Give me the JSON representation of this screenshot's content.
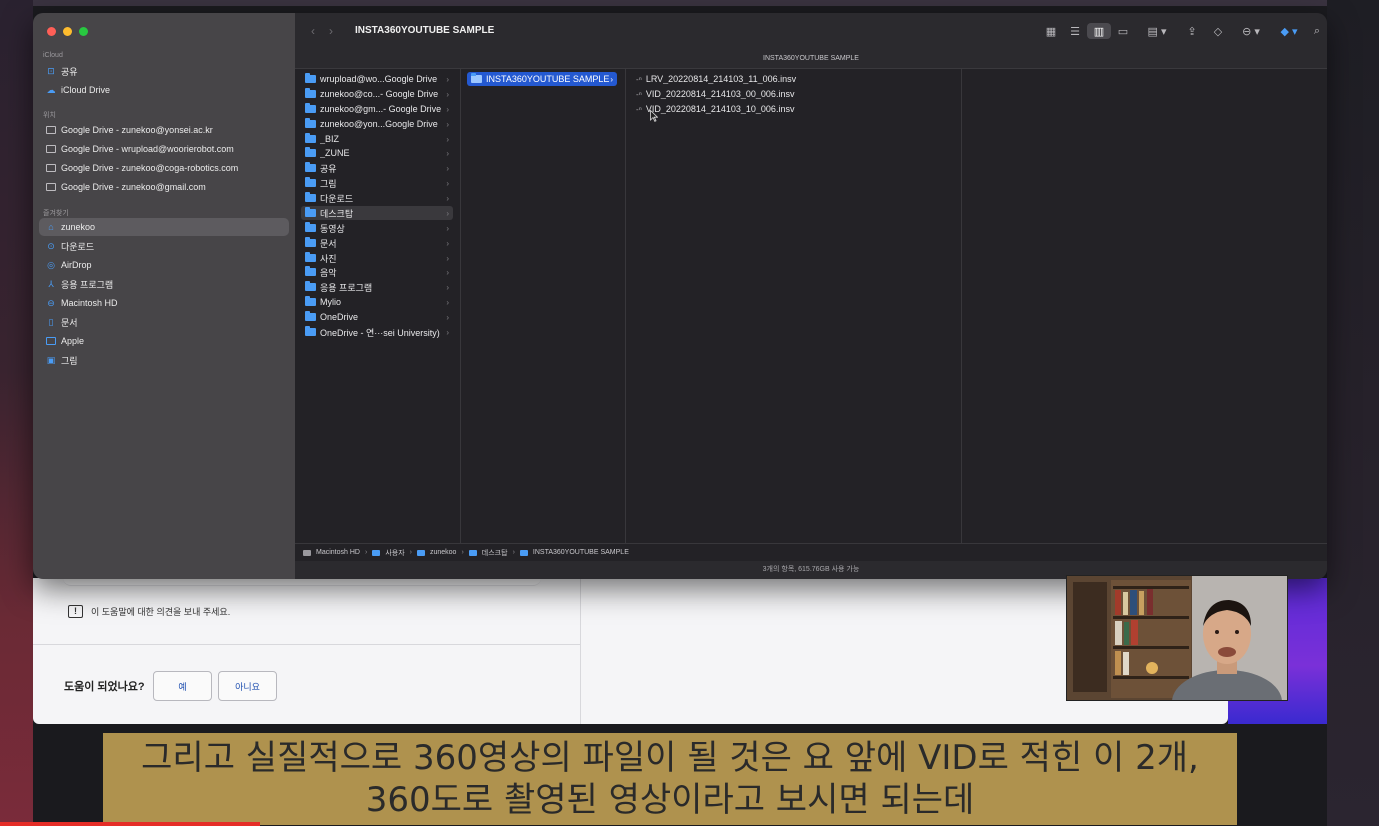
{
  "finder": {
    "window_title": "INSTA360YOUTUBE SAMPLE",
    "path_header": "INSTA360YOUTUBE SAMPLE",
    "status": "3개의 항목, 615.76GB 사용 가능",
    "sidebar": {
      "sections": [
        {
          "title": "iCloud",
          "items": [
            {
              "label": "공유",
              "icon": "shared-folder-icon"
            },
            {
              "label": "iCloud Drive",
              "icon": "cloud-icon"
            }
          ]
        },
        {
          "title": "위치",
          "items": [
            {
              "label": "Google Drive - zunekoo@yonsei.ac.kr",
              "icon": "folder-icon"
            },
            {
              "label": "Google Drive - wrupload@woorierobot.com",
              "icon": "folder-icon"
            },
            {
              "label": "Google Drive - zunekoo@coga-robotics.com",
              "icon": "folder-icon"
            },
            {
              "label": "Google Drive - zunekoo@gmail.com",
              "icon": "folder-icon"
            }
          ]
        },
        {
          "title": "즐겨찾기",
          "items": [
            {
              "label": "zunekoo",
              "icon": "home-icon",
              "selected": true
            },
            {
              "label": "다운로드",
              "icon": "download-icon"
            },
            {
              "label": "AirDrop",
              "icon": "airdrop-icon"
            },
            {
              "label": "응용 프로그램",
              "icon": "applications-icon"
            },
            {
              "label": "Macintosh HD",
              "icon": "hard-drive-icon"
            },
            {
              "label": "문서",
              "icon": "document-icon"
            },
            {
              "label": "Apple",
              "icon": "folder-icon"
            },
            {
              "label": "그림",
              "icon": "picture-icon"
            }
          ]
        }
      ]
    },
    "column1": [
      "wrupload@wo...Google Drive",
      "zunekoo@co...- Google Drive",
      "zunekoo@gm...- Google Drive",
      "zunekoo@yon...Google Drive",
      "_BIZ",
      "_ZUNE",
      "공유",
      "그림",
      "다운로드",
      "데스크탑",
      "동영상",
      "문서",
      "사진",
      "음악",
      "응용 프로그램",
      "Mylio",
      "OneDrive",
      "OneDrive - 연···sei University)"
    ],
    "column1_hover_index": 9,
    "column2": [
      "INSTA360YOUTUBE SAMPLE"
    ],
    "column3": [
      "LRV_20220814_214103_11_006.insv",
      "VID_20220814_214103_00_006.insv",
      "VID_20220814_214103_10_006.insv"
    ],
    "breadcrumb": [
      "Macintosh HD",
      "사용자",
      "zunekoo",
      "데스크탑",
      "INSTA360YOUTUBE SAMPLE"
    ]
  },
  "help_page": {
    "feedback_text": "이 도움말에 대한 의견을 보내 주세요.",
    "helpful_question": "도움이 되었나요?",
    "yes_label": "예",
    "no_label": "아니요"
  },
  "subtitle": {
    "line1": "그리고 실질적으로 360영상의 파일이 될 것은 요 앞에 VID로 적힌 이 2개,",
    "line2": "360도로 촬영된 영상이라고 보시면 되는데"
  },
  "colors": {
    "selection": "#2459d1",
    "folder": "#4a9cf5",
    "subtitle_bg": "#bc9c52",
    "progress": "#e52d27"
  }
}
